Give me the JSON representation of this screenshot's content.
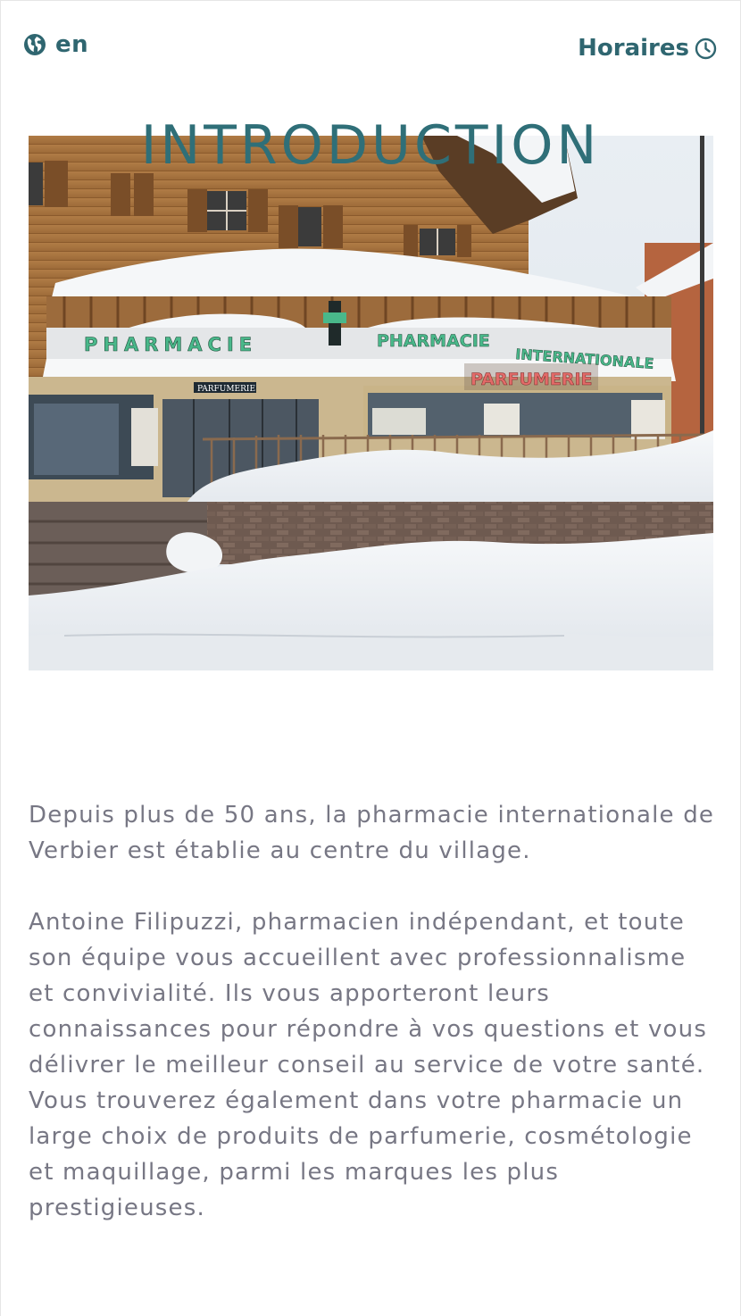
{
  "header": {
    "language": {
      "icon": "globe-icon",
      "label": "en"
    },
    "hours": {
      "label": "Horaires",
      "icon": "clock-icon"
    }
  },
  "section": {
    "title": "INTRODUCTION"
  },
  "hero": {
    "sign_left": "PHARMACIE",
    "sign_pharmacie": "PHARMACIE",
    "sign_internationale": "INTERNATIONALE",
    "sign_parfumerie": "PARFUMERIE",
    "sign_small": "PARFUMERIE"
  },
  "intro": {
    "paragraph1": "Depuis plus de 50 ans, la pharmacie internationale de Verbier est établie au centre du village.",
    "paragraph2": "Antoine Filipuzzi, pharmacien indépendant, et toute son équipe vous accueillent avec professionnalisme et convivialité. Ils vous apporteront leurs connaissances pour répondre à vos questions et vous délivrer le meilleur conseil au service de votre santé. Vous trouverez également dans votre pharmacie un large choix de produits de parfumerie, cosmétologie et maquillage, parmi les marques les plus prestigieuses."
  },
  "colors": {
    "accent": "#2f6670",
    "body_text": "#777784",
    "sign_green": "#49b88a",
    "sign_red": "#e26a68"
  }
}
